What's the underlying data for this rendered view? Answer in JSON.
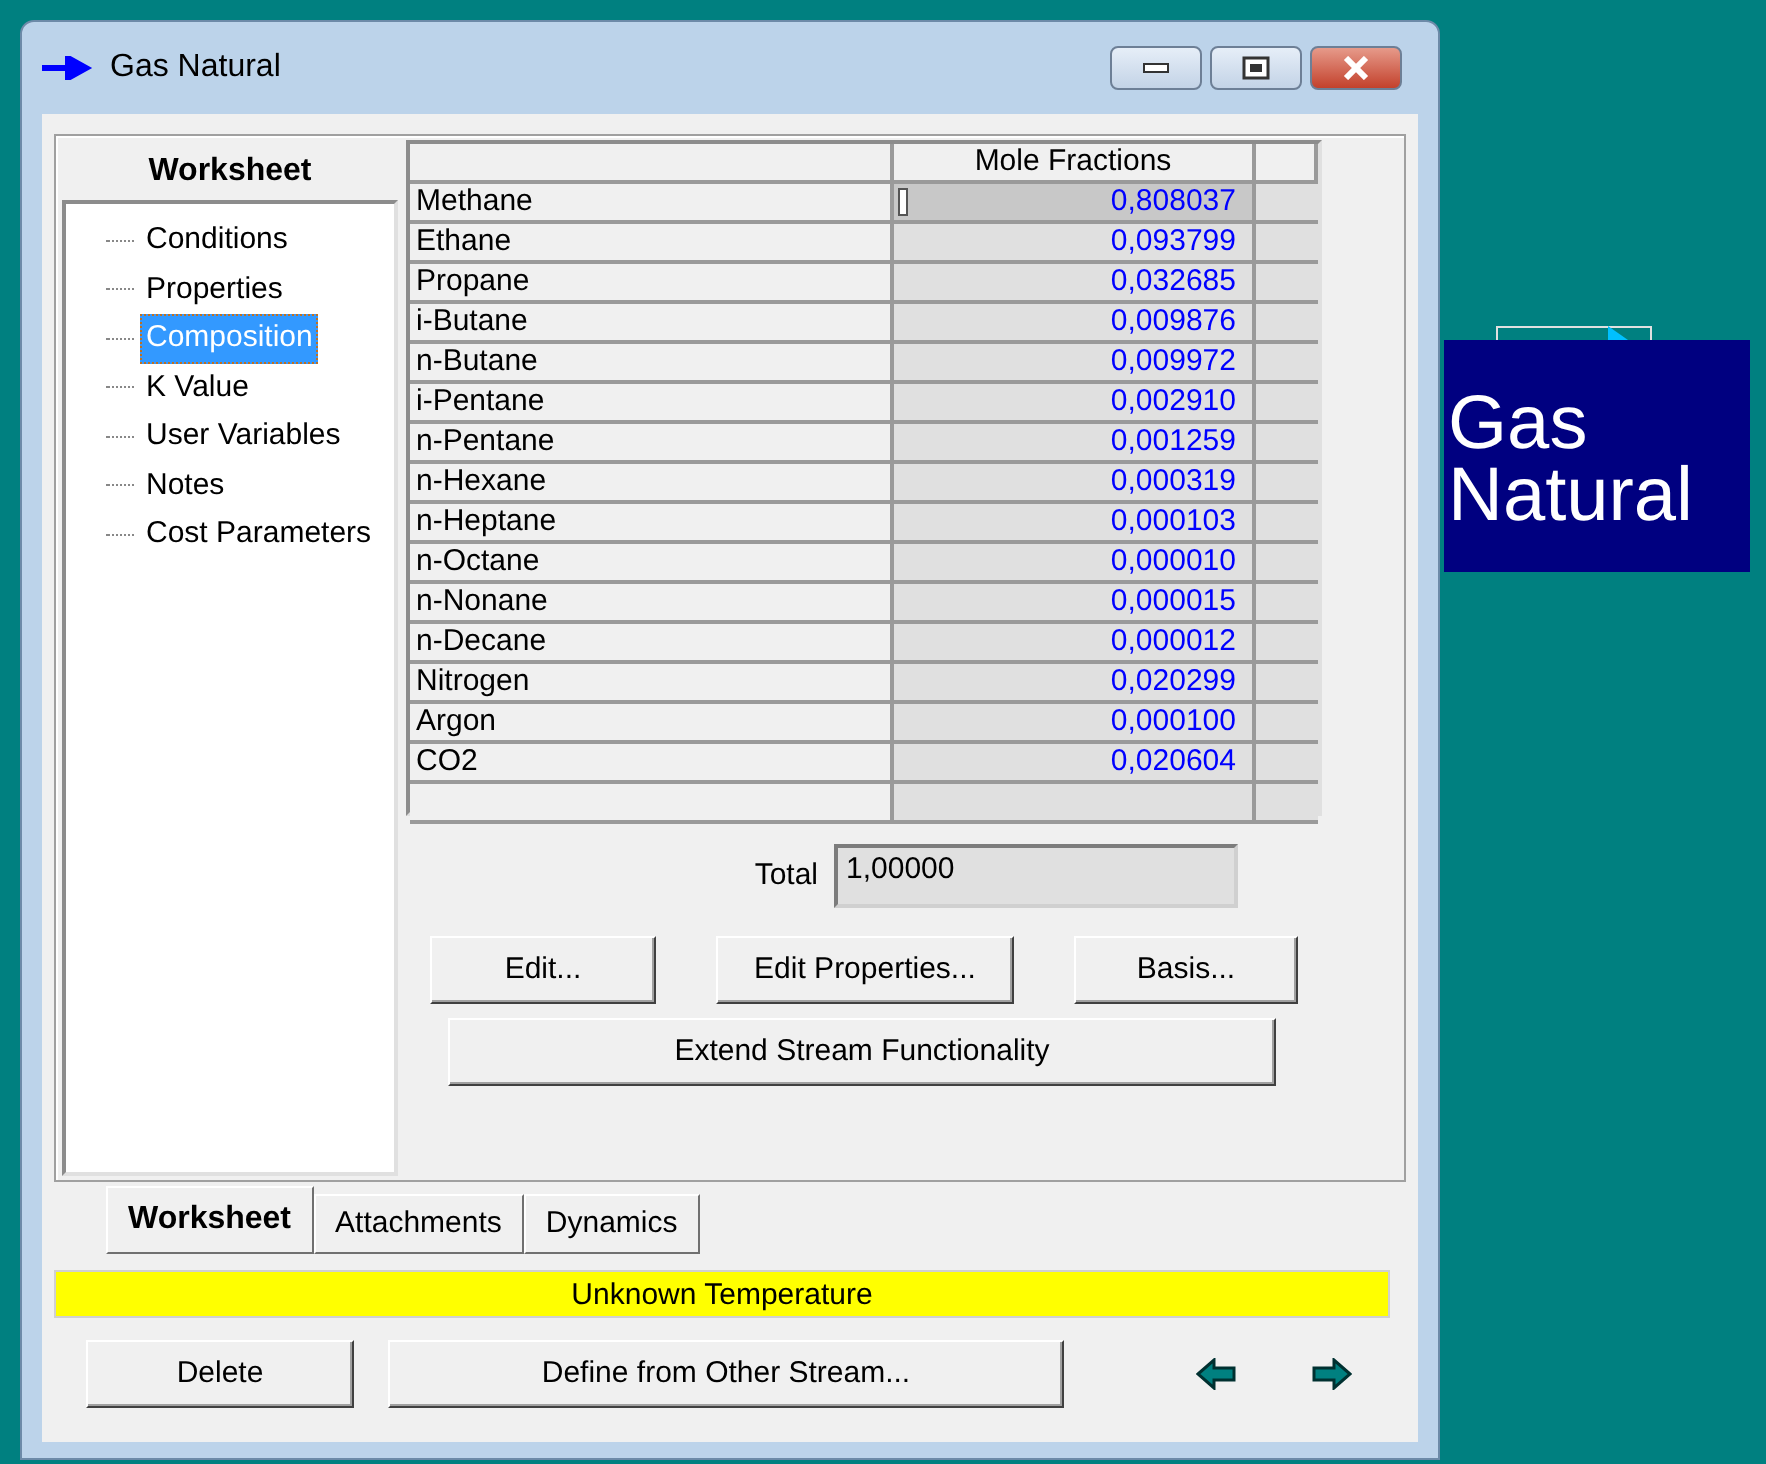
{
  "window": {
    "title": "Gas Natural"
  },
  "sidebar": {
    "title": "Worksheet",
    "items": [
      {
        "label": "Conditions",
        "selected": false
      },
      {
        "label": "Properties",
        "selected": false
      },
      {
        "label": "Composition",
        "selected": true
      },
      {
        "label": "K Value",
        "selected": false
      },
      {
        "label": "User Variables",
        "selected": false
      },
      {
        "label": "Notes",
        "selected": false
      },
      {
        "label": "Cost Parameters",
        "selected": false
      }
    ]
  },
  "table": {
    "columns": [
      "Mole Fractions"
    ],
    "rows": [
      {
        "name": "Methane",
        "value": "0,808037",
        "selected": true
      },
      {
        "name": "Ethane",
        "value": "0,093799",
        "selected": false
      },
      {
        "name": "Propane",
        "value": "0,032685",
        "selected": false
      },
      {
        "name": "i-Butane",
        "value": "0,009876",
        "selected": false
      },
      {
        "name": "n-Butane",
        "value": "0,009972",
        "selected": false
      },
      {
        "name": "i-Pentane",
        "value": "0,002910",
        "selected": false
      },
      {
        "name": "n-Pentane",
        "value": "0,001259",
        "selected": false
      },
      {
        "name": "n-Hexane",
        "value": "0,000319",
        "selected": false
      },
      {
        "name": "n-Heptane",
        "value": "0,000103",
        "selected": false
      },
      {
        "name": "n-Octane",
        "value": "0,000010",
        "selected": false
      },
      {
        "name": "n-Nonane",
        "value": "0,000015",
        "selected": false
      },
      {
        "name": "n-Decane",
        "value": "0,000012",
        "selected": false
      },
      {
        "name": "Nitrogen",
        "value": "0,020299",
        "selected": false
      },
      {
        "name": "Argon",
        "value": "0,000100",
        "selected": false
      },
      {
        "name": "CO2",
        "value": "0,020604",
        "selected": false
      }
    ]
  },
  "total": {
    "label": "Total",
    "value": "1,00000"
  },
  "buttons": [
    "Edit...",
    "Edit Properties...",
    "Basis..."
  ],
  "wide_button": "Extend Stream Functionality",
  "tabs": [
    {
      "label": "Worksheet",
      "selected": true
    },
    {
      "label": "Attachments",
      "selected": false
    },
    {
      "label": "Dynamics",
      "selected": false
    }
  ],
  "status_bar": "Unknown Temperature",
  "bottom_buttons": [
    "Delete",
    "Define from Other Stream..."
  ],
  "canvas_label": "Gas Natural"
}
